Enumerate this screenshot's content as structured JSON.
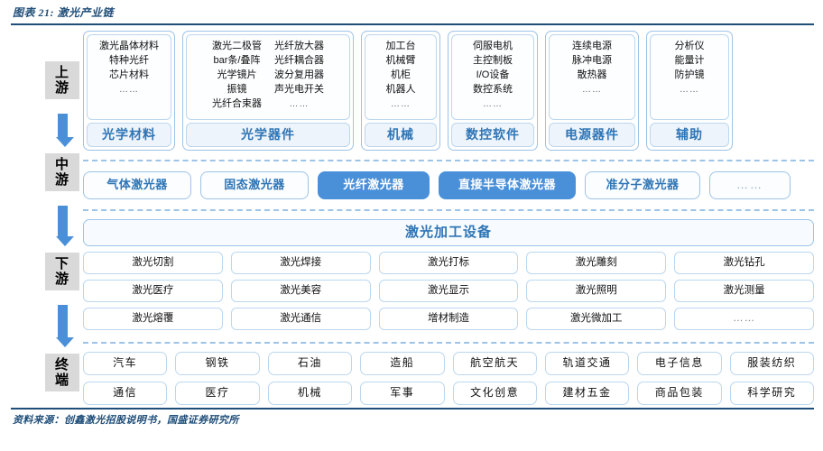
{
  "header": {
    "title": "图表 21: 激光产业链"
  },
  "stages": [
    {
      "id": "upstream",
      "label_chars": [
        "上",
        "游"
      ]
    },
    {
      "id": "midstream",
      "label_chars": [
        "中",
        "游"
      ]
    },
    {
      "id": "downstream",
      "label_chars": [
        "下",
        "游"
      ]
    },
    {
      "id": "terminal",
      "label_chars": [
        "终",
        "端"
      ]
    }
  ],
  "upstream": {
    "groups": [
      {
        "label": "光学材料",
        "width": 102,
        "columns": [
          [
            "激光晶体材料",
            "特种光纤",
            "芯片材料",
            "……"
          ]
        ]
      },
      {
        "label": "光学器件",
        "width": 190,
        "columns": [
          [
            "激光二极管",
            "bar条/叠阵",
            "光学镜片",
            "振镜",
            "光纤合束器"
          ],
          [
            "光纤放大器",
            "光纤耦合器",
            "波分复用器",
            "声光电开关",
            "……"
          ]
        ]
      },
      {
        "label": "机械",
        "width": 88,
        "columns": [
          [
            "加工台",
            "机械臂",
            "机柜",
            "机器人",
            "……"
          ]
        ]
      },
      {
        "label": "数控软件",
        "width": 100,
        "columns": [
          [
            "伺服电机",
            "主控制板",
            "I/O设备",
            "数控系统",
            "……"
          ]
        ]
      },
      {
        "label": "电源器件",
        "width": 104,
        "columns": [
          [
            "连续电源",
            "脉冲电源",
            "散热器",
            "……"
          ]
        ]
      },
      {
        "label": "辅助",
        "width": 96,
        "columns": [
          [
            "分析仪",
            "能量计",
            "防护镜",
            "……"
          ]
        ]
      }
    ]
  },
  "midstream": {
    "items": [
      {
        "label": "气体激光器",
        "highlighted": false,
        "width": 118
      },
      {
        "label": "固态激光器",
        "highlighted": false,
        "width": 118
      },
      {
        "label": "光纤激光器",
        "highlighted": true,
        "width": 122
      },
      {
        "label": "直接半导体激光器",
        "highlighted": true,
        "width": 150
      },
      {
        "label": "准分子激光器",
        "highlighted": false,
        "width": 126
      },
      {
        "label": "……",
        "highlighted": false,
        "width": 88
      }
    ]
  },
  "downstream": {
    "header": "激光加工设备",
    "rows": [
      [
        "激光切割",
        "激光焊接",
        "激光打标",
        "激光雕刻",
        "激光钻孔"
      ],
      [
        "激光医疗",
        "激光美容",
        "激光显示",
        "激光照明",
        "激光测量"
      ],
      [
        "激光熔覆",
        "激光通信",
        "增材制造",
        "激光微加工",
        "……"
      ]
    ]
  },
  "terminal": {
    "rows": [
      [
        "汽车",
        "钢铁",
        "石油",
        "造船",
        "航空航天",
        "轨道交通",
        "电子信息",
        "服装纺织"
      ],
      [
        "通信",
        "医疗",
        "机械",
        "军事",
        "文化创意",
        "建材五金",
        "商品包装",
        "科学研究"
      ]
    ]
  },
  "footer": {
    "source": "资料来源：创鑫激光招股说明书，国盛证券研究所"
  },
  "colors": {
    "accent_blue": "#2e75b6",
    "highlight_fill": "#4a90d9",
    "border_blue": "#9dc3e6",
    "rule_navy": "#1f4e79",
    "stage_gray": "#d9d9d9"
  }
}
